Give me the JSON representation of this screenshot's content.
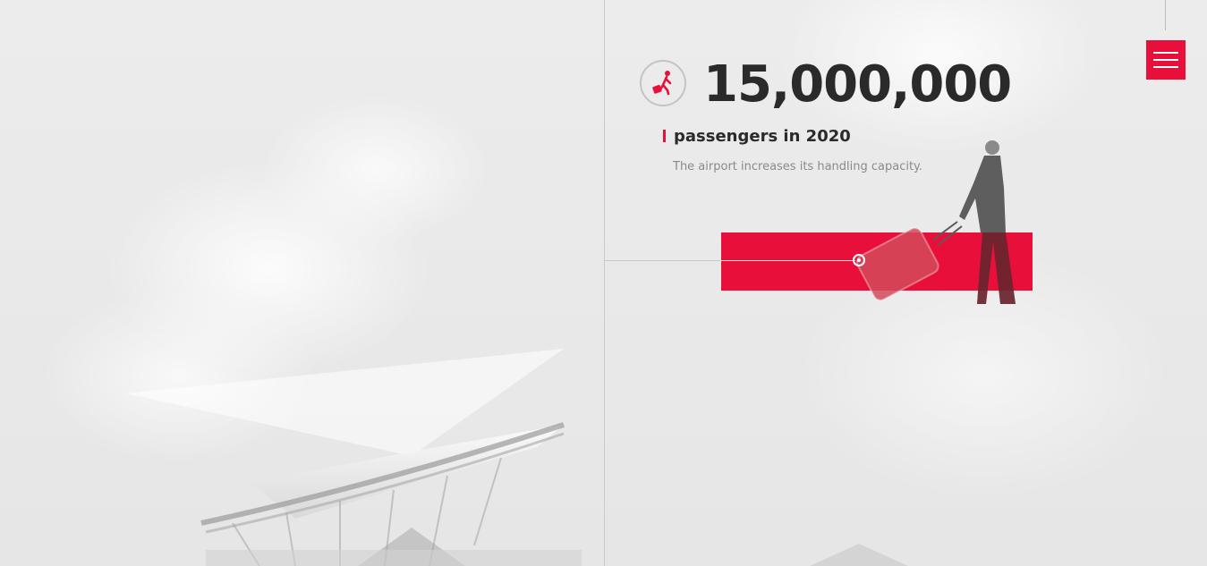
{
  "stat": {
    "value": "15,000,000",
    "label": "passengers in 2020",
    "description": "The airport increases its handling capacity."
  },
  "icons": {
    "stat_icon": "traveler-with-luggage-icon",
    "menu_icon": "hamburger-menu-icon"
  },
  "colors": {
    "accent": "#e8103a",
    "text_dark": "#2a2a2a",
    "text_muted": "#8a8a8a",
    "background": "#e9e9e9"
  }
}
